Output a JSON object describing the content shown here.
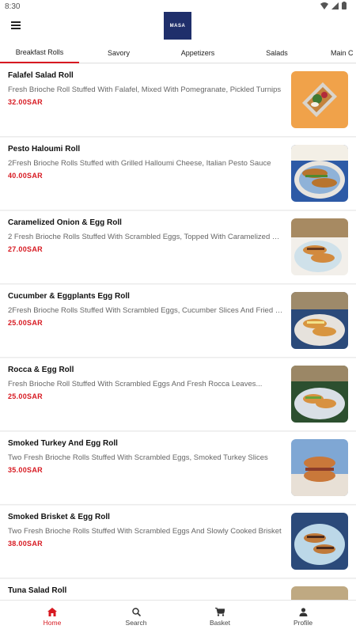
{
  "status": {
    "time": "8:30"
  },
  "header": {
    "logo_text": "MASA"
  },
  "tabs": [
    {
      "label": "Breakfast Rolls"
    },
    {
      "label": "Savory"
    },
    {
      "label": "Appetizers"
    },
    {
      "label": "Salads"
    },
    {
      "label": "Main C"
    }
  ],
  "items": [
    {
      "name": "Falafel Salad Roll",
      "desc": "Fresh Brioche Roll Stuffed With Falafel, Mixed With Pomegranate, Pickled Turnips",
      "price": "32.00SAR"
    },
    {
      "name": "Pesto Haloumi Roll",
      "desc": "2Fresh Brioche Rolls Stuffed with Grilled Halloumi Cheese, Italian Pesto Sauce",
      "price": "40.00SAR"
    },
    {
      "name": "Caramelized Onion & Egg Roll",
      "desc": "2 Fresh Brioche Rolls Stuffed With Scrambled Eggs, Topped With Caramelized Onion",
      "price": "27.00SAR"
    },
    {
      "name": "Cucumber & Eggplants Egg Roll",
      "desc": "2Fresh Brioche Rolls Stuffed With Scrambled Eggs, Cucumber Slices And Fried Eggplants",
      "price": "25.00SAR"
    },
    {
      "name": "Rocca & Egg Roll",
      "desc": "Fresh Brioche Roll Stuffed With Scrambled Eggs And Fresh Rocca Leaves...",
      "price": "25.00SAR"
    },
    {
      "name": "Smoked Turkey And Egg Roll",
      "desc": "Two Fresh Brioche Rolls Stuffed With Scrambled Eggs, Smoked Turkey Slices",
      "price": "35.00SAR"
    },
    {
      "name": "Smoked Brisket & Egg Roll",
      "desc": "Two Fresh Brioche Rolls Stuffed With Scrambled Eggs And Slowly Cooked Brisket",
      "price": "38.00SAR"
    },
    {
      "name": "Tuna Salad Roll",
      "desc": "",
      "price": ""
    }
  ],
  "bottom_nav": [
    {
      "label": "Home",
      "icon": "home-icon"
    },
    {
      "label": "Search",
      "icon": "search-icon"
    },
    {
      "label": "Basket",
      "icon": "cart-icon"
    },
    {
      "label": "Profile",
      "icon": "profile-icon"
    }
  ],
  "colors": {
    "accent": "#d71921",
    "logo_bg": "#1f2f6b"
  }
}
